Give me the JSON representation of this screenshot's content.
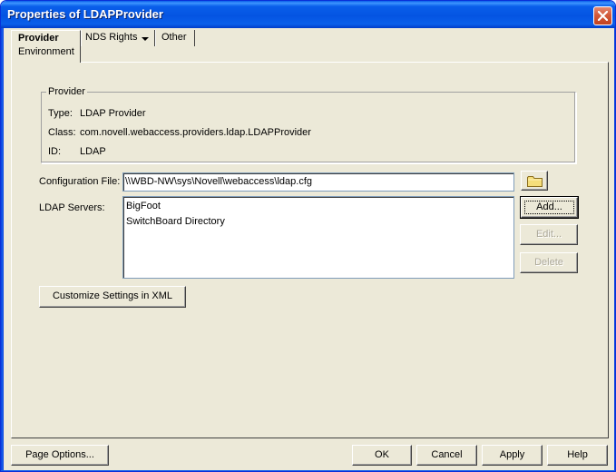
{
  "window": {
    "title": "Properties of LDAPProvider"
  },
  "tabs": {
    "provider": {
      "line1": "Provider",
      "line2": "Environment"
    },
    "nds_rights": "NDS Rights",
    "other": "Other"
  },
  "provider_group": {
    "legend": "Provider",
    "type_label": "Type:",
    "type_value": "LDAP Provider",
    "class_label": "Class:",
    "class_value": "com.novell.webaccess.providers.ldap.LDAPProvider",
    "id_label": "ID:",
    "id_value": "LDAP"
  },
  "config": {
    "label": "Configuration File:",
    "value": "\\\\WBD-NW\\sys\\Novell\\webaccess\\ldap.cfg"
  },
  "ldap_servers": {
    "label": "LDAP Servers:",
    "items": [
      "BigFoot",
      "SwitchBoard Directory"
    ],
    "add_label": "Add...",
    "edit_label": "Edit...",
    "delete_label": "Delete"
  },
  "customize_label": "Customize Settings in XML",
  "footer": {
    "page_options": "Page Options...",
    "ok": "OK",
    "cancel": "Cancel",
    "apply": "Apply",
    "help": "Help"
  },
  "icons": {
    "close": "close-icon",
    "browse": "folder-icon",
    "dropdown": "dropdown-arrow-icon"
  },
  "colors": {
    "titlebar": "#0a5fea",
    "dialog_bg": "#ece9d8",
    "close_button": "#d35a3b"
  }
}
